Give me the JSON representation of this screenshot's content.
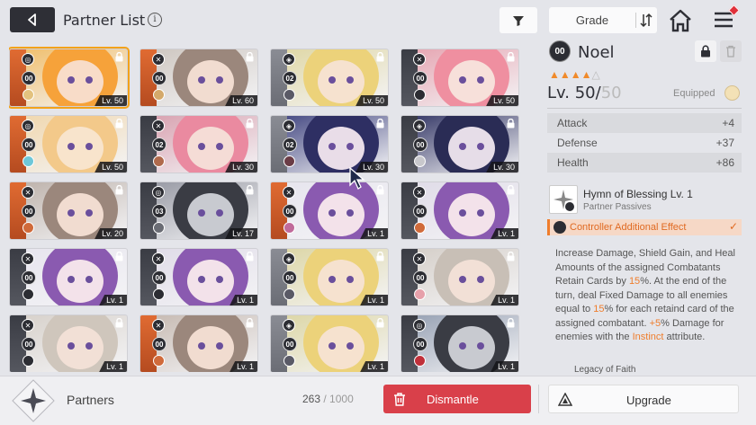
{
  "header": {
    "title": "Partner List",
    "info_glyph": "i",
    "sort_label": "Grade",
    "icons": [
      "back-arrow-icon",
      "info-icon",
      "filter-icon",
      "sort-toggle-icon",
      "home-icon",
      "menu-icon"
    ]
  },
  "cards": [
    {
      "rank": "00",
      "level": "Lv. 50",
      "selected": true,
      "rail": "fire",
      "hair": "#f6a23a",
      "skin": "#f8dcc8",
      "bg": "#f0c070",
      "elem": "#e3c27e",
      "cls": "◎"
    },
    {
      "rank": "00",
      "level": "Lv. 60",
      "selected": false,
      "rail": "fire",
      "hair": "#9b877c",
      "skin": "#f1dcd0",
      "bg": "#cfc8c2",
      "elem": "#d4a96a",
      "cls": "✕"
    },
    {
      "rank": "02",
      "level": "Lv. 50",
      "selected": false,
      "rail": "gray",
      "hair": "#ecd27a",
      "skin": "#f6e2cf",
      "bg": "#e0d8a8",
      "elem": "#5a5a66",
      "cls": "◈"
    },
    {
      "rank": "00",
      "level": "Lv. 50",
      "selected": false,
      "rail": "dark",
      "hair": "#ef8fa0",
      "skin": "#f7e0da",
      "bg": "#e6a8b4",
      "elem": "#2c2d33",
      "cls": "✕"
    },
    {
      "rank": "00",
      "level": "Lv. 50",
      "selected": false,
      "rail": "fire",
      "hair": "#f3c98a",
      "skin": "#f8e4cc",
      "bg": "#f0d8b0",
      "elem": "#6ec7d8",
      "cls": "◎"
    },
    {
      "rank": "02",
      "level": "Lv. 30",
      "selected": false,
      "rail": "dark",
      "hair": "#ea8aa0",
      "skin": "#f5dcd6",
      "bg": "#d9a4b2",
      "elem": "#b06a4c",
      "cls": "✕"
    },
    {
      "rank": "02",
      "level": "Lv. 30",
      "selected": false,
      "rail": "gray",
      "hair": "#2e2f63",
      "skin": "#e9dde8",
      "bg": "#4a4e86",
      "elem": "#6a3c46",
      "cls": "◈"
    },
    {
      "rank": "00",
      "level": "Lv. 30",
      "selected": false,
      "rail": "dark",
      "hair": "#2a2c55",
      "skin": "#e6dde8",
      "bg": "#3c3f6c",
      "elem": "#c8c8cc",
      "cls": "◈"
    },
    {
      "rank": "00",
      "level": "Lv. 20",
      "selected": false,
      "rail": "fire",
      "hair": "#9b877c",
      "skin": "#f1dcd0",
      "bg": "#bfb4ad",
      "elem": "#d06a3a",
      "cls": "✕"
    },
    {
      "rank": "03",
      "level": "Lv. 17",
      "selected": false,
      "rail": "dark",
      "hair": "#3a3c44",
      "skin": "#c8cad0",
      "bg": "#9a9ca6",
      "elem": "#6a6c74",
      "cls": "◎"
    },
    {
      "rank": "00",
      "level": "Lv. 1",
      "selected": false,
      "rail": "fire",
      "hair": "#8a5ab0",
      "skin": "#f3e2ea",
      "bg": "#e7e5ee",
      "elem": "#c06a9a",
      "cls": "✕"
    },
    {
      "rank": "00",
      "level": "Lv. 1",
      "selected": false,
      "rail": "dark",
      "hair": "#8a5ab0",
      "skin": "#f3e2ea",
      "bg": "#e0dce8",
      "elem": "#d06a3a",
      "cls": "✕"
    },
    {
      "rank": "00",
      "level": "Lv. 1",
      "selected": false,
      "rail": "dark",
      "hair": "#8a5ab0",
      "skin": "#f3e2ea",
      "bg": "#e7e5ee",
      "elem": "#2c2d33",
      "cls": "✕"
    },
    {
      "rank": "00",
      "level": "Lv. 1",
      "selected": false,
      "rail": "dark",
      "hair": "#8a5ab0",
      "skin": "#f3e2ea",
      "bg": "#e0dce8",
      "elem": "#2c2d33",
      "cls": "✕"
    },
    {
      "rank": "00",
      "level": "Lv. 1",
      "selected": false,
      "rail": "gray",
      "hair": "#ecd27a",
      "skin": "#f6e2cf",
      "bg": "#ddd7a8",
      "elem": "#5a5a66",
      "cls": "◈"
    },
    {
      "rank": "00",
      "level": "Lv. 1",
      "selected": false,
      "rail": "dark",
      "hair": "#c8bfb6",
      "skin": "#f2e0d6",
      "bg": "#d6d0ca",
      "elem": "#e6a0aa",
      "cls": "✕"
    },
    {
      "rank": "00",
      "level": "Lv. 1",
      "selected": false,
      "rail": "dark",
      "hair": "#cfc6bc",
      "skin": "#f2e0d6",
      "bg": "#d8d2cc",
      "elem": "#2c2d33",
      "cls": "✕"
    },
    {
      "rank": "00",
      "level": "Lv. 1",
      "selected": false,
      "rail": "fire",
      "hair": "#9b877c",
      "skin": "#f1dcd0",
      "bg": "#c8bcb4",
      "elem": "#d06a3a",
      "cls": "✕"
    },
    {
      "rank": "00",
      "level": "Lv. 1",
      "selected": false,
      "rail": "gray",
      "hair": "#ecd27a",
      "skin": "#f6e2cf",
      "bg": "#ddd7a8",
      "elem": "#5a5a66",
      "cls": "◈"
    },
    {
      "rank": "00",
      "level": "Lv. 1",
      "selected": false,
      "rail": "dark",
      "hair": "#3a3c44",
      "skin": "#c8cad0",
      "bg": "#9aa4b6",
      "elem": "#c0303a",
      "cls": "◎"
    }
  ],
  "detail": {
    "rank": "00",
    "name": "Noel",
    "stars_filled": "▲▲▲▲",
    "stars_empty": "△",
    "level": "Lv. 50/",
    "level_max": "50",
    "equipped_label": "Equipped",
    "stats": [
      {
        "label": "Attack",
        "value": "+4"
      },
      {
        "label": "Defense",
        "value": "+37"
      },
      {
        "label": "Health",
        "value": "+86"
      }
    ],
    "skill_name": "Hymn of Blessing Lv. 1",
    "skill_sub": "Partner Passives",
    "controller_label": "Controller Additional Effect",
    "controller_check": "✓",
    "desc": {
      "p1": "Increase Damage, Shield Gain, and Heal Amounts of the assigned Combatants Retain Cards by ",
      "v1": "15",
      "p2": "%. At the end of the turn, deal Fixed Damage to all enemies equal to ",
      "v2": "15",
      "p3": "% for each retaind card of the assigned combatant. ",
      "v3": "+5",
      "p4": "% Damage for enemies with the ",
      "v4": "Instinct",
      "p5": " attribute."
    },
    "next_skill_partial": "Legacy of Faith"
  },
  "bottom": {
    "label": "Partners",
    "count": "263",
    "count_sep": " / ",
    "count_max": "1000",
    "dismantle_label": "Dismantle",
    "upgrade_label": "Upgrade"
  },
  "colors": {
    "accent": "#ef7d2c",
    "danger": "#d9404a",
    "selected": "#f3a21a",
    "dark": "#2e2f36"
  }
}
